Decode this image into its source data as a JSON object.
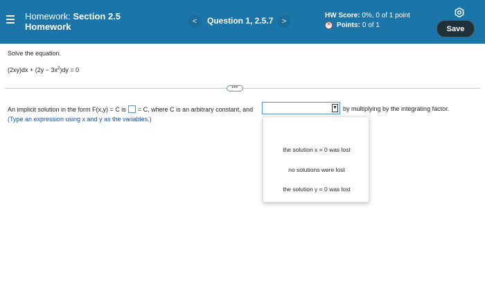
{
  "header": {
    "title_prefix": "Homework:",
    "title_section": "Section 2.5",
    "subtitle": "Homework",
    "prev_icon": "<",
    "next_icon": ">",
    "question_label": "Question 1, 2.5.7",
    "hw_score_label": "HW Score:",
    "hw_score_value": "0%, 0 of 1 point",
    "points_label": "Points:",
    "points_value": "0 of 1",
    "save_label": "Save",
    "colors": {
      "header_bg": "#1b75a8",
      "save_bg": "#1e3038",
      "error": "#d9452e"
    }
  },
  "problem": {
    "instruction": "Solve the equation.",
    "equation_part1": "(2xy)dx + (2y − 3x",
    "equation_exp": "2",
    "equation_part2": ")dy = 0",
    "more_label": "•••",
    "prompt_before_box": "An implicit solution in the form F(x,y) = C is",
    "prompt_after_box": "= C, where C is an arbitrary constant, and",
    "prompt_after_dropdown": "by multiplying by the integrating factor.",
    "hint": "(Type an expression using x and y as the variables.)",
    "dropdown_arrow": "▼",
    "dropdown_options": [
      "the solution x = 0 was lost",
      "no solutions were lost",
      "the solution y = 0 was lost"
    ]
  }
}
